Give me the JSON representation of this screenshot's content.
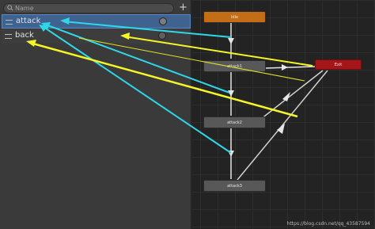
{
  "parameters": {
    "search_placeholder": "Name",
    "add_label": "+",
    "items": [
      {
        "name": "attack",
        "type": "trigger",
        "selected": true
      },
      {
        "name": "back",
        "type": "trigger",
        "selected": false
      }
    ]
  },
  "graph": {
    "states": {
      "idle": "Idle",
      "attack1": "attack1",
      "attack2": "attack2",
      "attack3": "attack3",
      "exit": "Exit"
    }
  },
  "watermark": "https://blog.csdn.net/qq_43587594",
  "colors": {
    "entry_state": "#c46d17",
    "exit_state": "#a5161b",
    "selected_row": "#3f628f",
    "annotation_cyan": "#2fd6e8",
    "annotation_yellow": "#f5f52a"
  }
}
